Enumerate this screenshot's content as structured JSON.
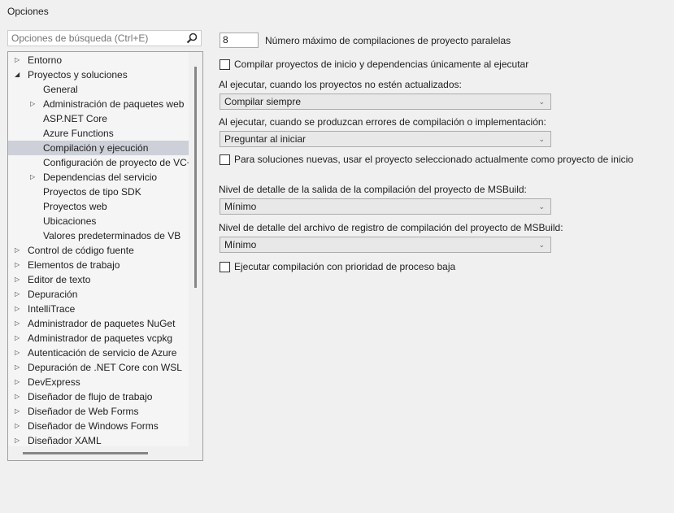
{
  "window": {
    "title": "Opciones"
  },
  "search": {
    "placeholder": "Opciones de búsqueda (Ctrl+E)"
  },
  "tree": [
    {
      "label": "Entorno",
      "level": 0,
      "state": "collapsed"
    },
    {
      "label": "Proyectos y soluciones",
      "level": 0,
      "state": "expanded"
    },
    {
      "label": "General",
      "level": 1,
      "state": "leaf"
    },
    {
      "label": "Administración de paquetes web",
      "level": 1,
      "state": "collapsed"
    },
    {
      "label": "ASP.NET Core",
      "level": 1,
      "state": "leaf"
    },
    {
      "label": "Azure Functions",
      "level": 1,
      "state": "leaf"
    },
    {
      "label": "Compilación y ejecución",
      "level": 1,
      "state": "leaf",
      "selected": true
    },
    {
      "label": "Configuración de proyecto de VC++",
      "level": 1,
      "state": "leaf"
    },
    {
      "label": "Dependencias del servicio",
      "level": 1,
      "state": "collapsed"
    },
    {
      "label": "Proyectos de tipo SDK",
      "level": 1,
      "state": "leaf"
    },
    {
      "label": "Proyectos web",
      "level": 1,
      "state": "leaf"
    },
    {
      "label": "Ubicaciones",
      "level": 1,
      "state": "leaf"
    },
    {
      "label": "Valores predeterminados de VB",
      "level": 1,
      "state": "leaf"
    },
    {
      "label": "Control de código fuente",
      "level": 0,
      "state": "collapsed"
    },
    {
      "label": "Elementos de trabajo",
      "level": 0,
      "state": "collapsed"
    },
    {
      "label": "Editor de texto",
      "level": 0,
      "state": "collapsed"
    },
    {
      "label": "Depuración",
      "level": 0,
      "state": "collapsed"
    },
    {
      "label": "IntelliTrace",
      "level": 0,
      "state": "collapsed"
    },
    {
      "label": "Administrador de paquetes NuGet",
      "level": 0,
      "state": "collapsed"
    },
    {
      "label": "Administrador de paquetes vcpkg",
      "level": 0,
      "state": "collapsed"
    },
    {
      "label": "Autenticación de servicio de Azure",
      "level": 0,
      "state": "collapsed"
    },
    {
      "label": "Depuración de .NET Core con WSL",
      "level": 0,
      "state": "collapsed"
    },
    {
      "label": "DevExpress",
      "level": 0,
      "state": "collapsed"
    },
    {
      "label": "Diseñador de flujo de trabajo",
      "level": 0,
      "state": "collapsed"
    },
    {
      "label": "Diseñador de Web Forms",
      "level": 0,
      "state": "collapsed"
    },
    {
      "label": "Diseñador de Windows Forms",
      "level": 0,
      "state": "collapsed"
    },
    {
      "label": "Diseñador XAML",
      "level": 0,
      "state": "collapsed"
    }
  ],
  "settings": {
    "parallel_value": "8",
    "parallel_label": "Número máximo de compilaciones de proyecto paralelas",
    "build_startup_label": "Compilar proyectos de inicio y dependencias únicamente al ejecutar",
    "build_startup_checked": false,
    "outdated_label": "Al ejecutar, cuando los proyectos no estén actualizados:",
    "outdated_value": "Compilar siempre",
    "errors_label": "Al ejecutar, cuando se produzcan errores de compilación o implementación:",
    "errors_value": "Preguntar al iniciar",
    "new_solutions_label": "Para soluciones nuevas, usar el proyecto seleccionado actualmente como proyecto de inicio",
    "new_solutions_checked": false,
    "msbuild_output_label": "Nivel de detalle de la salida de la compilación del proyecto de MSBuild:",
    "msbuild_output_value": "Mínimo",
    "msbuild_log_label": "Nivel de detalle del archivo de registro de compilación del proyecto de MSBuild:",
    "msbuild_log_value": "Mínimo",
    "low_priority_label": "Ejecutar compilación con prioridad de proceso baja",
    "low_priority_checked": false
  }
}
